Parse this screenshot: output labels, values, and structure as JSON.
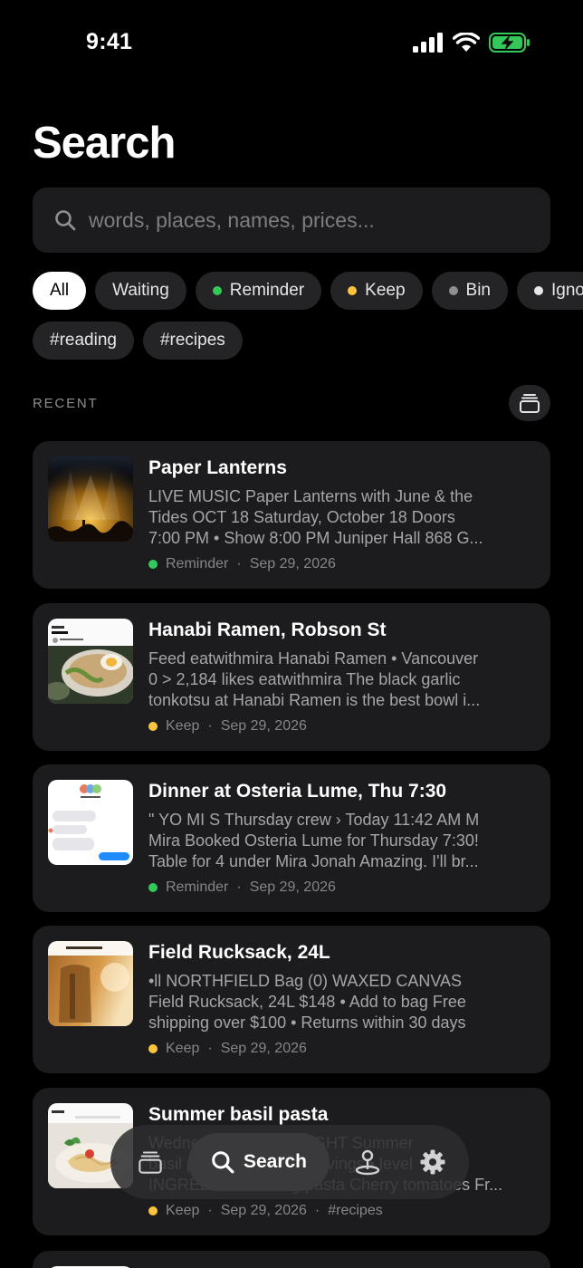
{
  "status": {
    "time": "9:41"
  },
  "page": {
    "title": "Search"
  },
  "search": {
    "placeholder": "words, places, names, prices..."
  },
  "filters": {
    "row1": [
      {
        "label": "All",
        "dot": "",
        "active": true
      },
      {
        "label": "Waiting",
        "dot": ""
      },
      {
        "label": "Reminder",
        "dot": "#34c759"
      },
      {
        "label": "Keep",
        "dot": "#ffc43d"
      },
      {
        "label": "Bin",
        "dot": "#8e8e93"
      },
      {
        "label": "Ignore",
        "dot": "#e5e5ea"
      }
    ],
    "row2": [
      {
        "label": "#reading"
      },
      {
        "label": "#recipes"
      }
    ]
  },
  "recent": {
    "label": "RECENT"
  },
  "cards": [
    {
      "title": "Paper Lanterns",
      "lines": [
        "LIVE MUSIC Paper Lanterns with June & the",
        "Tides OCT 18 Saturday, October 18 Doors",
        "7:00 PM • Show 8:00 PM Juniper Hall 868 G..."
      ],
      "tag": "Reminder",
      "tag_color": "#34c759",
      "date": "Sep 29, 2026",
      "extra": "",
      "thumb": "concert-thumbnail"
    },
    {
      "title": "Hanabi Ramen, Robson St",
      "lines": [
        "Feed eatwithmira Hanabi Ramen • Vancouver",
        "0 > 2,184 likes eatwithmira The black garlic",
        "tonkotsu at Hanabi Ramen is the best bowl i..."
      ],
      "tag": "Keep",
      "tag_color": "#ffc43d",
      "date": "Sep 29, 2026",
      "extra": "",
      "thumb": "ramen-thumbnail"
    },
    {
      "title": "Dinner at Osteria Lume, Thu 7:30",
      "lines": [
        "\" YO MI S Thursday crew › Today 11:42 AM M",
        "Mira Booked Osteria Lume for Thursday 7:30!",
        "Table for 4 under Mira Jonah Amazing. I'll br..."
      ],
      "tag": "Reminder",
      "tag_color": "#34c759",
      "date": "Sep 29, 2026",
      "extra": "",
      "thumb": "messages-thumbnail"
    },
    {
      "title": "Field Rucksack, 24L",
      "lines": [
        "•ll NORTHFIELD Bag (0) WAXED CANVAS",
        "Field Rucksack, 24L $148 • Add to bag Free",
        "shipping over $100 • Returns within 30 days"
      ],
      "tag": "Keep",
      "tag_color": "#ffc43d",
      "date": "Sep 29, 2026",
      "extra": "",
      "thumb": "rucksack-thumbnail"
    },
    {
      "title": "Summer basil pasta",
      "lines": [
        "Wednesday • WEEKNIGHT Summer",
        "basil pasta • easy • 4 servings • level",
        "INGREDIENTS 400g pasta Cherry tomatoes Fr..."
      ],
      "tag": "Keep",
      "tag_color": "#ffc43d",
      "date": "Sep 29, 2026",
      "extra": "#recipes",
      "thumb": "pasta-thumbnail"
    }
  ],
  "tabbar": {
    "search_label": "Search"
  }
}
